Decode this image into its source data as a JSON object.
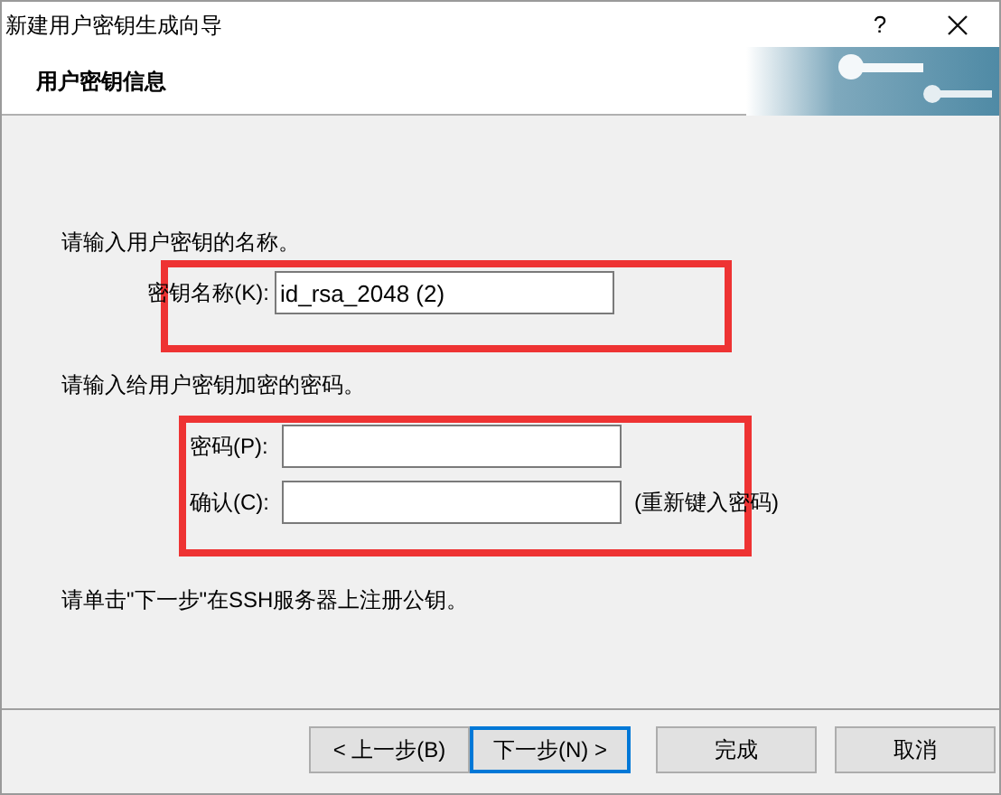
{
  "window": {
    "title": "新建用户密钥生成向导",
    "help": "?"
  },
  "header": {
    "title": "用户密钥信息"
  },
  "name_section": {
    "prompt": "请输入用户密钥的名称。",
    "label": "密钥名称(K):",
    "value": "id_rsa_2048 (2)"
  },
  "password_section": {
    "prompt": "请输入给用户密钥加密的密码。",
    "fields": [
      {
        "label": "密码(P):"
      },
      {
        "label": "确认(C):",
        "hint": "(重新键入密码)"
      }
    ]
  },
  "note": "请单击\"下一步\"在SSH服务器上注册公钥。",
  "buttons": [
    {
      "label": "< 上一步(B)",
      "default": false
    },
    {
      "label": "下一步(N) >",
      "default": true
    },
    {
      "label": "完成",
      "default": false
    },
    {
      "label": "取消",
      "default": false
    }
  ],
  "annotations": [
    {
      "kind": "highlight",
      "color": "#ee3333"
    },
    {
      "kind": "highlight",
      "color": "#ee3333"
    }
  ]
}
